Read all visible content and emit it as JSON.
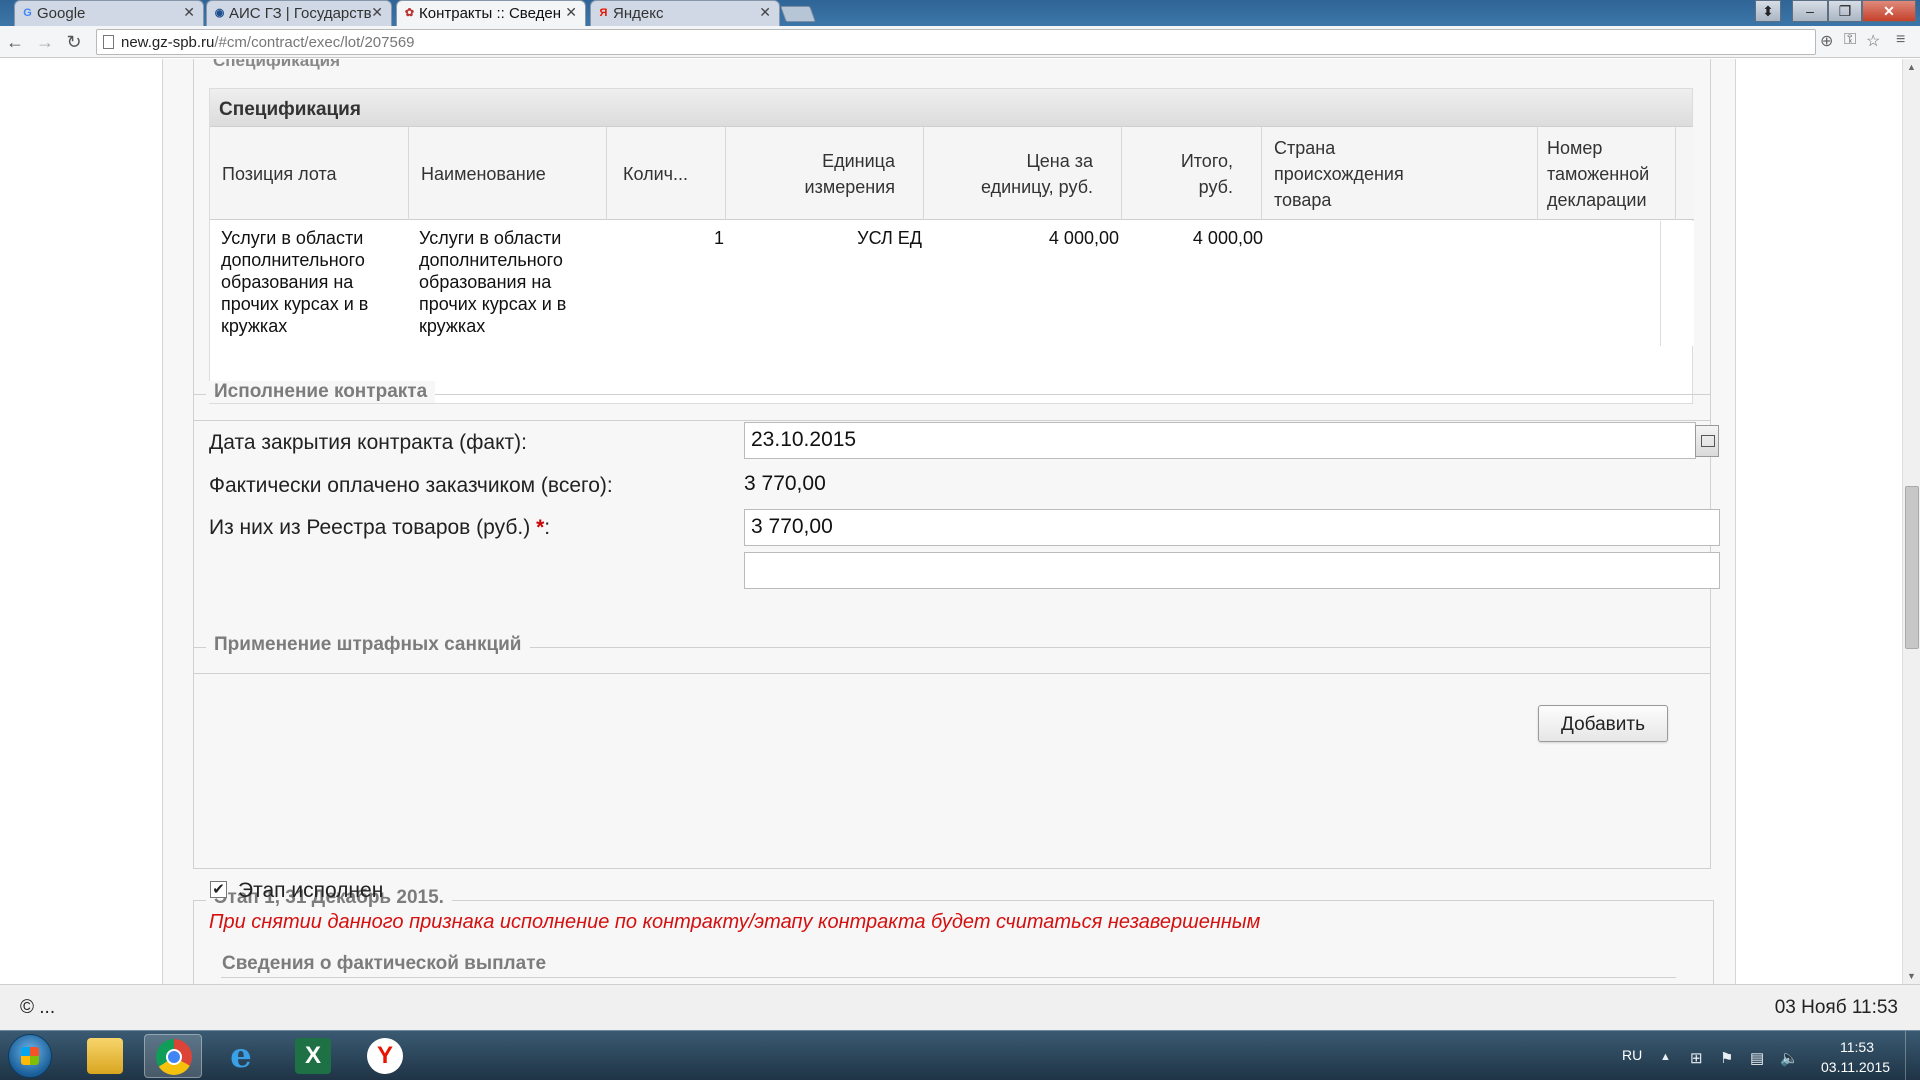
{
  "browser": {
    "tabs": [
      {
        "label": "Google",
        "favicon": "G"
      },
      {
        "label": "АИС ГЗ | Государств",
        "favicon": "◉"
      },
      {
        "label": "Контракты :: Сведен",
        "favicon": "✿"
      },
      {
        "label": "Яндекс",
        "favicon": "Я"
      }
    ],
    "url_host": "new.gz-spb.ru",
    "url_path": "/#cm/contract/exec/lot/207569"
  },
  "page": {
    "cut_header": "Спецификация",
    "spec": {
      "title": "Спецификация",
      "headers": [
        "Позиция лота",
        "Наименование",
        "Колич...",
        "Единица измерения",
        "Цена за единицу, руб.",
        "Итого, руб.",
        "Страна происхождения товара",
        "Номер таможенной декларации"
      ],
      "row": {
        "position": "Услуги в области дополнительного образования на прочих курсах и в кружках",
        "name": "Услуги в области дополнительного образования на прочих курсах и в кружках",
        "qty": "1",
        "unit": "УСЛ ЕД",
        "price": "4 000,00",
        "total": "4 000,00",
        "country": "",
        "customs": ""
      }
    },
    "execution": {
      "legend": "Исполнение контракта",
      "close_date_label": "Дата закрытия контракта (факт):",
      "close_date_value": "23.10.2015",
      "paid_label": "Фактически оплачено заказчиком (всего):",
      "paid_value": "3 770,00",
      "registry_label": "Из них из Реестра товаров (руб.)",
      "registry_required": "*",
      "registry_colon": ":",
      "registry_value": "3 770,00",
      "extra_value": ""
    },
    "penalties": {
      "legend": "Применение штрафных санкций",
      "add_button": "Добавить"
    },
    "stage": {
      "legend": "Этап 1, 31 Декабрь 2015.",
      "done_label": "Этап исполнен",
      "done_checked": true,
      "warning": "При снятии данного признака исполнение по контракту/этапу контракта будет считаться незавершенным",
      "payment_legend": "Сведения о фактической выплате"
    }
  },
  "statusbar": {
    "left": "© ...",
    "right": "03 Нояб 11:53"
  },
  "taskbar": {
    "lang": "RU",
    "time": "11:53",
    "date": "03.11.2015"
  },
  "colors": {
    "warning": "#d41010",
    "required": "#cc0000",
    "legend": "#7c7c7c"
  }
}
